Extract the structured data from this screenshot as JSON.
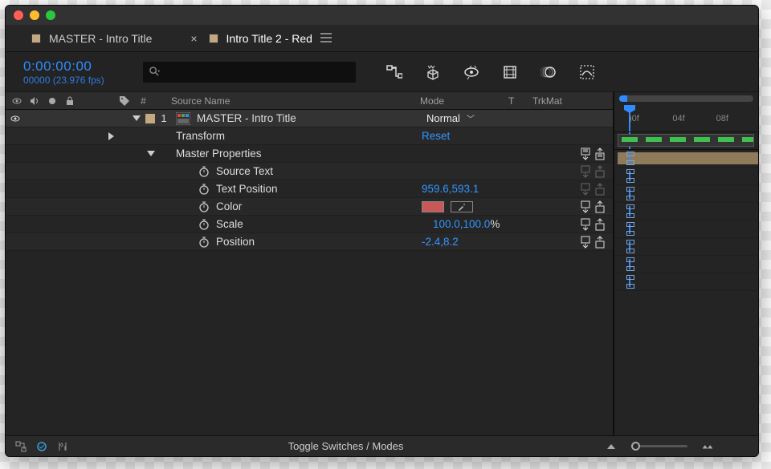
{
  "tabs": {
    "tab1": "MASTER - Intro Title",
    "tab2": "Intro Title 2 - Red"
  },
  "time": {
    "code": "0:00:00:00",
    "frames": "00000 (23.976 fps)"
  },
  "columns": {
    "idx": "#",
    "name": "Source Name",
    "mode": "Mode",
    "t": "T",
    "trk": "TrkMat"
  },
  "layer": {
    "index": "1",
    "name": "MASTER - Intro Title",
    "mode": "Normal",
    "transform": "Transform",
    "reset": "Reset",
    "master": "Master Properties",
    "p_source": "Source Text",
    "p_textpos": "Text Position",
    "p_color": "Color",
    "p_scale": "Scale",
    "p_position": "Position",
    "v_textpos": "959.6,593.1",
    "v_scale": "100.0,100.0",
    "v_pct": "%",
    "v_position": "-2.4,8.2"
  },
  "ruler": {
    "t0": ")0f",
    "t1": "04f",
    "t2": "08f"
  },
  "footer": {
    "toggle": "Toggle Switches / Modes"
  }
}
